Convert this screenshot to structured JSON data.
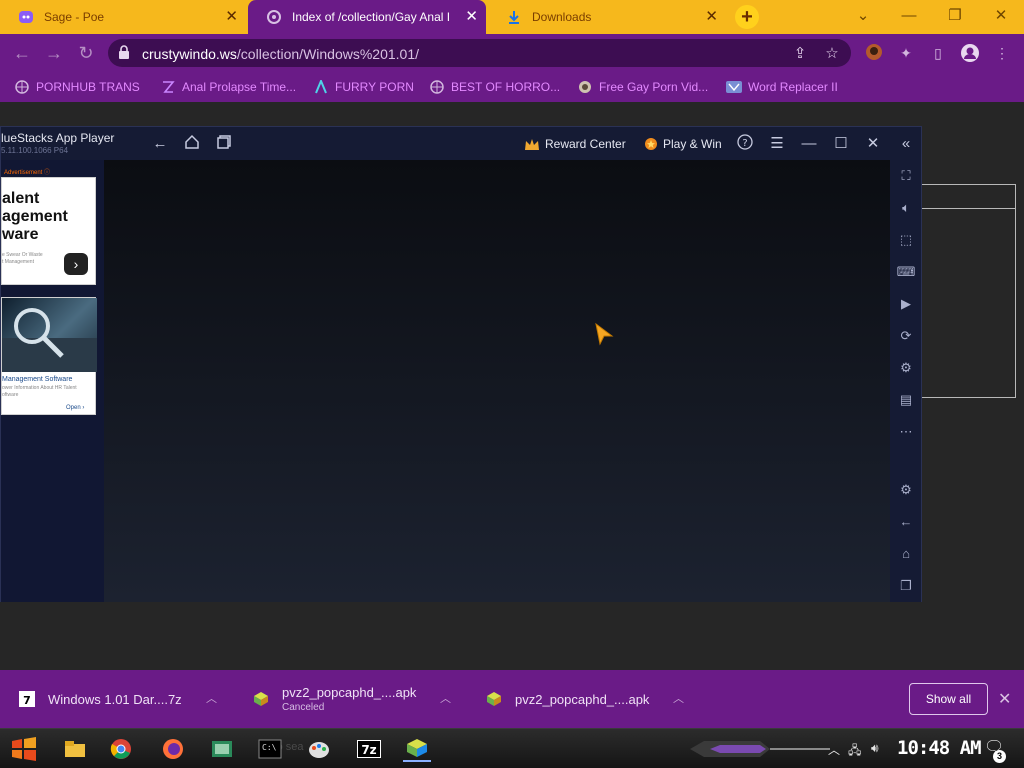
{
  "browser": {
    "tabs": [
      {
        "title": "Sage - Poe",
        "icon": "poe-icon",
        "active": false
      },
      {
        "title": "Index of /collection/Gay Anal I",
        "icon": "site-icon",
        "active": true
      },
      {
        "title": "Downloads",
        "icon": "download-icon",
        "active": false
      }
    ],
    "new_tab_label": "+",
    "url_host": "crustywindo.ws",
    "url_path": "/collection/Windows%201.01/",
    "colors": {
      "tabstrip": "#f6b81c",
      "toolbar": "#6a1b87",
      "bookmark_text": "#e389ff"
    }
  },
  "bookmarks": [
    {
      "label": "PORNHUB TRANS",
      "icon": "globe-icon"
    },
    {
      "label": "Anal Prolapse Time...",
      "icon": "bookmark-icon"
    },
    {
      "label": "FURRY PORN",
      "icon": "arch-icon"
    },
    {
      "label": "BEST OF HORRO...",
      "icon": "globe-icon"
    },
    {
      "label": "Free Gay Porn Vid...",
      "icon": "site-icon"
    },
    {
      "label": "Word Replacer II",
      "icon": "extension-icon"
    }
  ],
  "bluestacks": {
    "title": "lueStacks App Player",
    "version": "5.11.100.1066  P64",
    "reward_center": "Reward Center",
    "play_win": "Play & Win",
    "ad1": {
      "label": "Advertisement ⓘ",
      "headline": [
        "alent",
        "agement",
        "ware"
      ],
      "small": [
        "e Swear Or Waste",
        "t Management"
      ]
    },
    "ad2": {
      "title": "Management Software",
      "sub": [
        "ower Information About HR Talent",
        "oftware"
      ],
      "cta": "Open ›"
    }
  },
  "downloads": [
    {
      "name": "Windows 1.01 Dar....7z",
      "status": "",
      "icon": "archive-icon"
    },
    {
      "name": "pvz2_popcaphd_....apk",
      "status": "Canceled",
      "icon": "apk-icon"
    },
    {
      "name": "pvz2_popcaphd_....apk",
      "status": "",
      "icon": "apk-icon"
    }
  ],
  "show_all_label": "Show all",
  "taskbar": {
    "clock": "10:48 AM",
    "notification_count": "3",
    "ghost_text": "s to sea"
  }
}
